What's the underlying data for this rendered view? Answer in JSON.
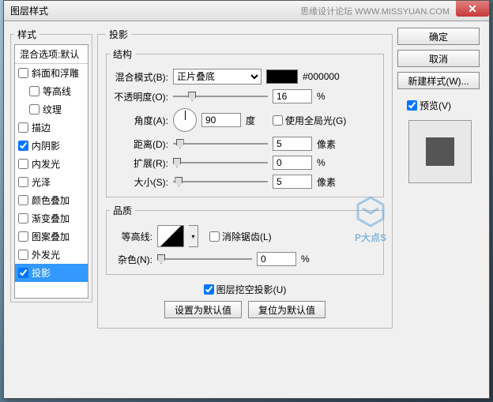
{
  "window": {
    "title": "图层样式",
    "forum": "思缘设计论坛  WWW.MISSYUAN.COM"
  },
  "styles": {
    "legend": "样式",
    "header": "混合选项:默认",
    "items": [
      {
        "label": "斜面和浮雕",
        "checked": false,
        "indent": false
      },
      {
        "label": "等高线",
        "checked": false,
        "indent": true
      },
      {
        "label": "纹理",
        "checked": false,
        "indent": true
      },
      {
        "label": "描边",
        "checked": false,
        "indent": false
      },
      {
        "label": "内阴影",
        "checked": true,
        "indent": false
      },
      {
        "label": "内发光",
        "checked": false,
        "indent": false
      },
      {
        "label": "光泽",
        "checked": false,
        "indent": false
      },
      {
        "label": "颜色叠加",
        "checked": false,
        "indent": false
      },
      {
        "label": "渐变叠加",
        "checked": false,
        "indent": false
      },
      {
        "label": "图案叠加",
        "checked": false,
        "indent": false
      },
      {
        "label": "外发光",
        "checked": false,
        "indent": false
      },
      {
        "label": "投影",
        "checked": true,
        "indent": false,
        "selected": true
      }
    ]
  },
  "main": {
    "section_title": "投影",
    "structure": {
      "legend": "结构",
      "blend_mode_label": "混合模式(B):",
      "blend_mode_value": "正片叠底",
      "color_hex": "#000000",
      "opacity_label": "不透明度(O):",
      "opacity_value": "16",
      "opacity_unit": "%",
      "angle_label": "角度(A):",
      "angle_value": "90",
      "angle_unit": "度",
      "global_light_label": "使用全局光(G)",
      "global_light_checked": false,
      "distance_label": "距离(D):",
      "distance_value": "5",
      "distance_unit": "像素",
      "spread_label": "扩展(R):",
      "spread_value": "0",
      "spread_unit": "%",
      "size_label": "大小(S):",
      "size_value": "5",
      "size_unit": "像素"
    },
    "quality": {
      "legend": "品质",
      "contour_label": "等高线:",
      "antialias_label": "消除锯齿(L)",
      "antialias_checked": false,
      "noise_label": "杂色(N):",
      "noise_value": "0",
      "noise_unit": "%"
    },
    "knockout_label": "图层挖空投影(U)",
    "knockout_checked": true,
    "set_default": "设置为默认值",
    "reset_default": "复位为默认值"
  },
  "buttons": {
    "ok": "确定",
    "cancel": "取消",
    "new_style": "新建样式(W)...",
    "preview_label": "预览(V)",
    "preview_checked": true
  },
  "watermark": "P大点S"
}
